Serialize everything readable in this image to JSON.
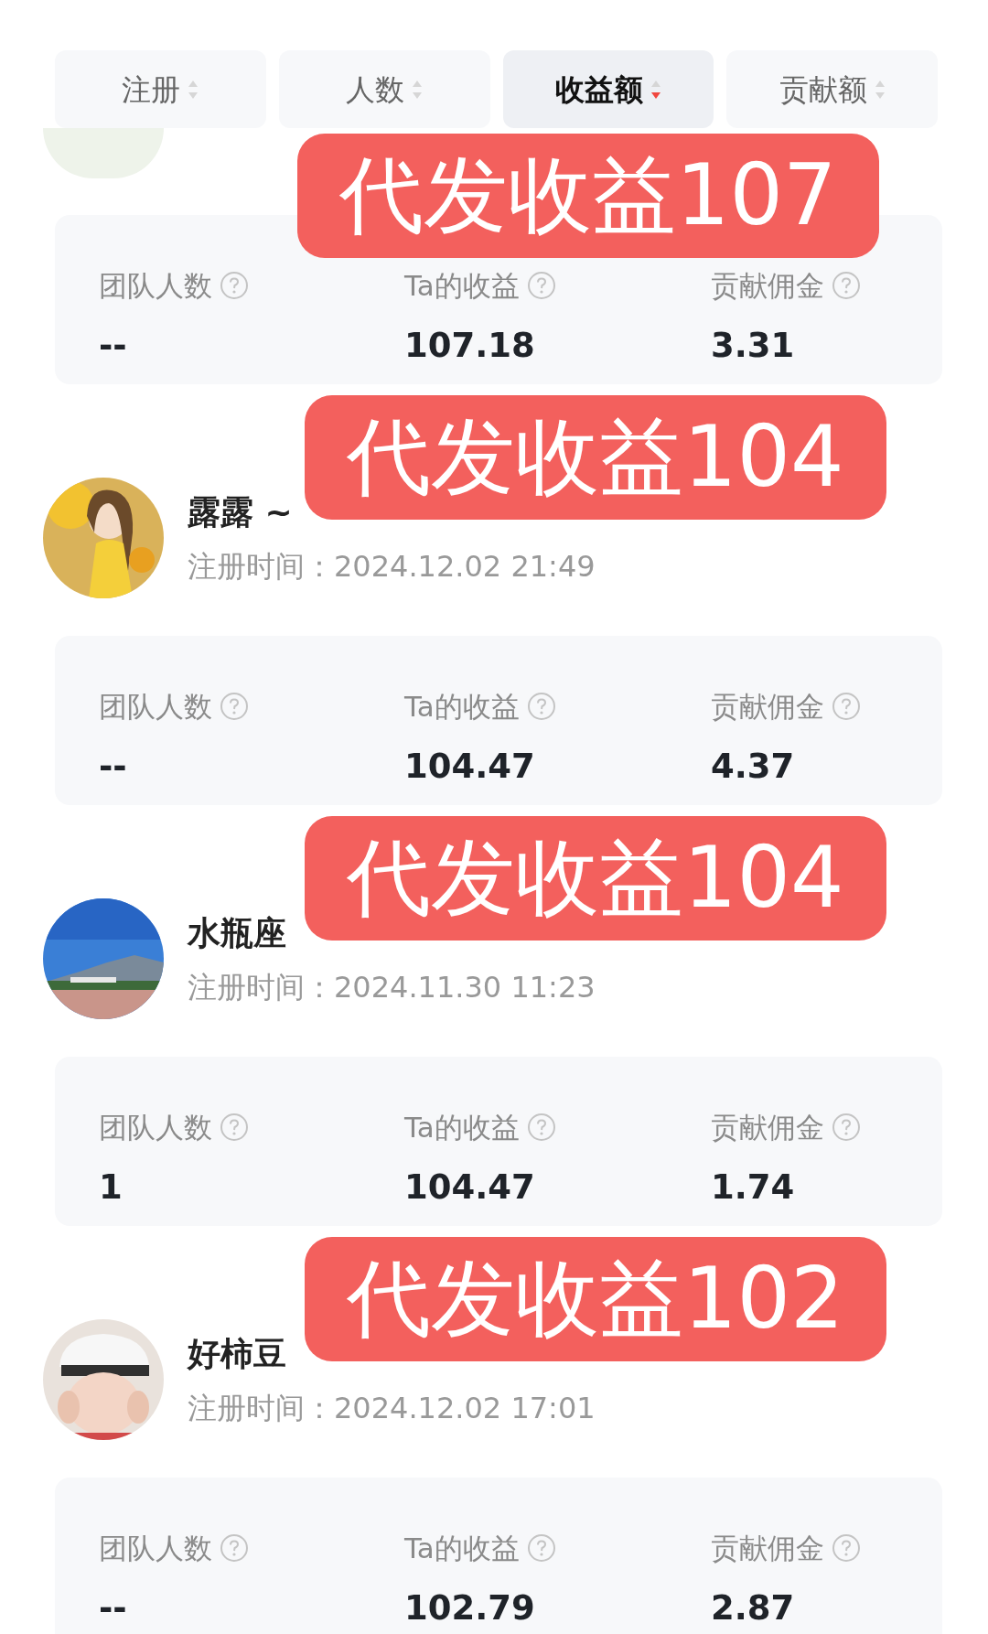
{
  "sort_tabs": [
    {
      "label": "注册",
      "selected": false
    },
    {
      "label": "人数",
      "selected": false
    },
    {
      "label": "收益额",
      "selected": true
    },
    {
      "label": "贡献额",
      "selected": false
    }
  ],
  "members": [
    {
      "kind": "cut",
      "overlay": "代发收益107",
      "stats": [
        {
          "label": "团队人数",
          "value": "--"
        },
        {
          "label": "Ta的收益",
          "value": "107.18"
        },
        {
          "label": "贡献佣金",
          "value": "3.31"
        }
      ]
    },
    {
      "kind": "full",
      "name": "露露 ~",
      "registered_label": "注册时间：",
      "registered": "2024.12.02 21:49",
      "overlay": "代发收益104",
      "stats": [
        {
          "label": "团队人数",
          "value": "--"
        },
        {
          "label": "Ta的收益",
          "value": "104.47"
        },
        {
          "label": "贡献佣金",
          "value": "4.37"
        }
      ]
    },
    {
      "kind": "full",
      "name": "水瓶座",
      "registered_label": "注册时间：",
      "registered": "2024.11.30 11:23",
      "overlay": "代发收益104",
      "stats": [
        {
          "label": "团队人数",
          "value": "1"
        },
        {
          "label": "Ta的收益",
          "value": "104.47"
        },
        {
          "label": "贡献佣金",
          "value": "1.74"
        }
      ]
    },
    {
      "kind": "full",
      "name": "好柿豆",
      "registered_label": "注册时间：",
      "registered": "2024.12.02 17:01",
      "overlay": "代发收益102",
      "stats": [
        {
          "label": "团队人数",
          "value": "--"
        },
        {
          "label": "Ta的收益",
          "value": "102.79"
        },
        {
          "label": "贡献佣金",
          "value": "2.87"
        }
      ]
    }
  ]
}
